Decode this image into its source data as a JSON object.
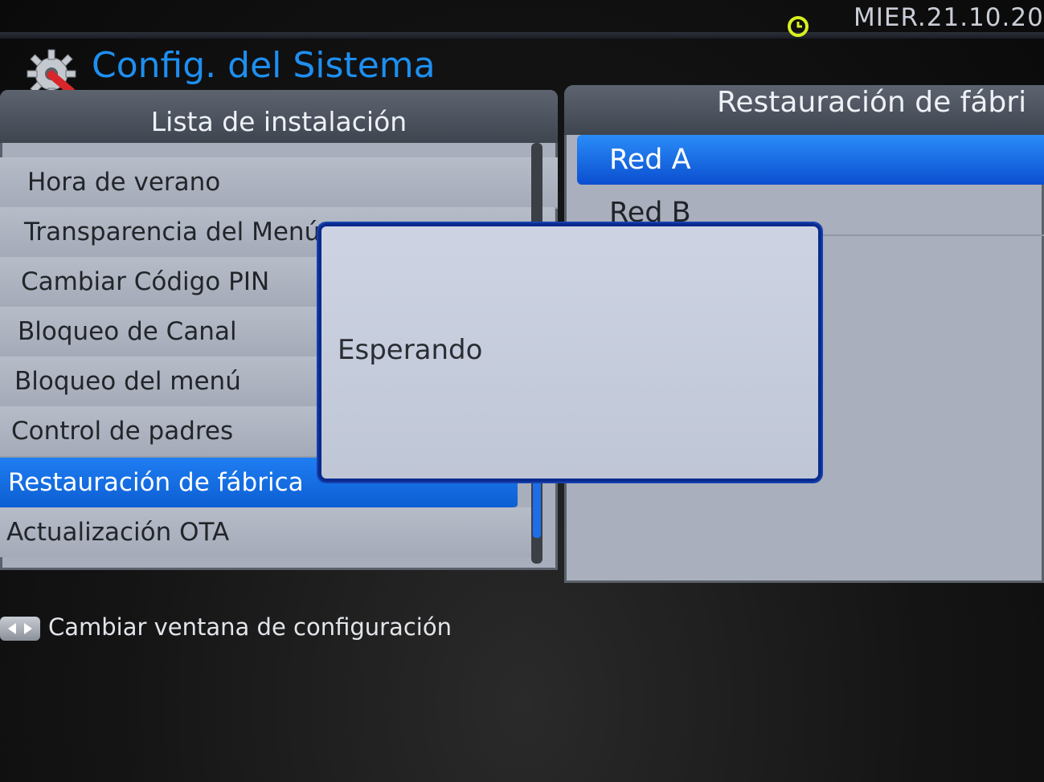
{
  "status": {
    "datetime": "MIER.21.10.20"
  },
  "header": {
    "title": "Config. del Sistema"
  },
  "left_panel": {
    "title": "Lista de instalación",
    "items": [
      {
        "label": "Hora de verano"
      },
      {
        "label": "Transparencia del Menú"
      },
      {
        "label": "Cambiar Código PIN"
      },
      {
        "label": "Bloqueo de Canal"
      },
      {
        "label": "Bloqueo del menú"
      },
      {
        "label": "Control de padres"
      },
      {
        "label": "Restauración de fábrica"
      },
      {
        "label": "Actualización OTA"
      }
    ],
    "selected_index": 6
  },
  "right_panel": {
    "title": "Restauración de fábri",
    "items": [
      {
        "label": "Red A"
      },
      {
        "label": "Red B"
      }
    ],
    "selected_index": 0
  },
  "dialog": {
    "message": "Esperando"
  },
  "footer": {
    "hint": "Cambiar ventana de configuración"
  },
  "colors": {
    "accent": "#1e8ff0",
    "selection": "#0c5fd2",
    "dialog_border": "#0a2a8e"
  }
}
